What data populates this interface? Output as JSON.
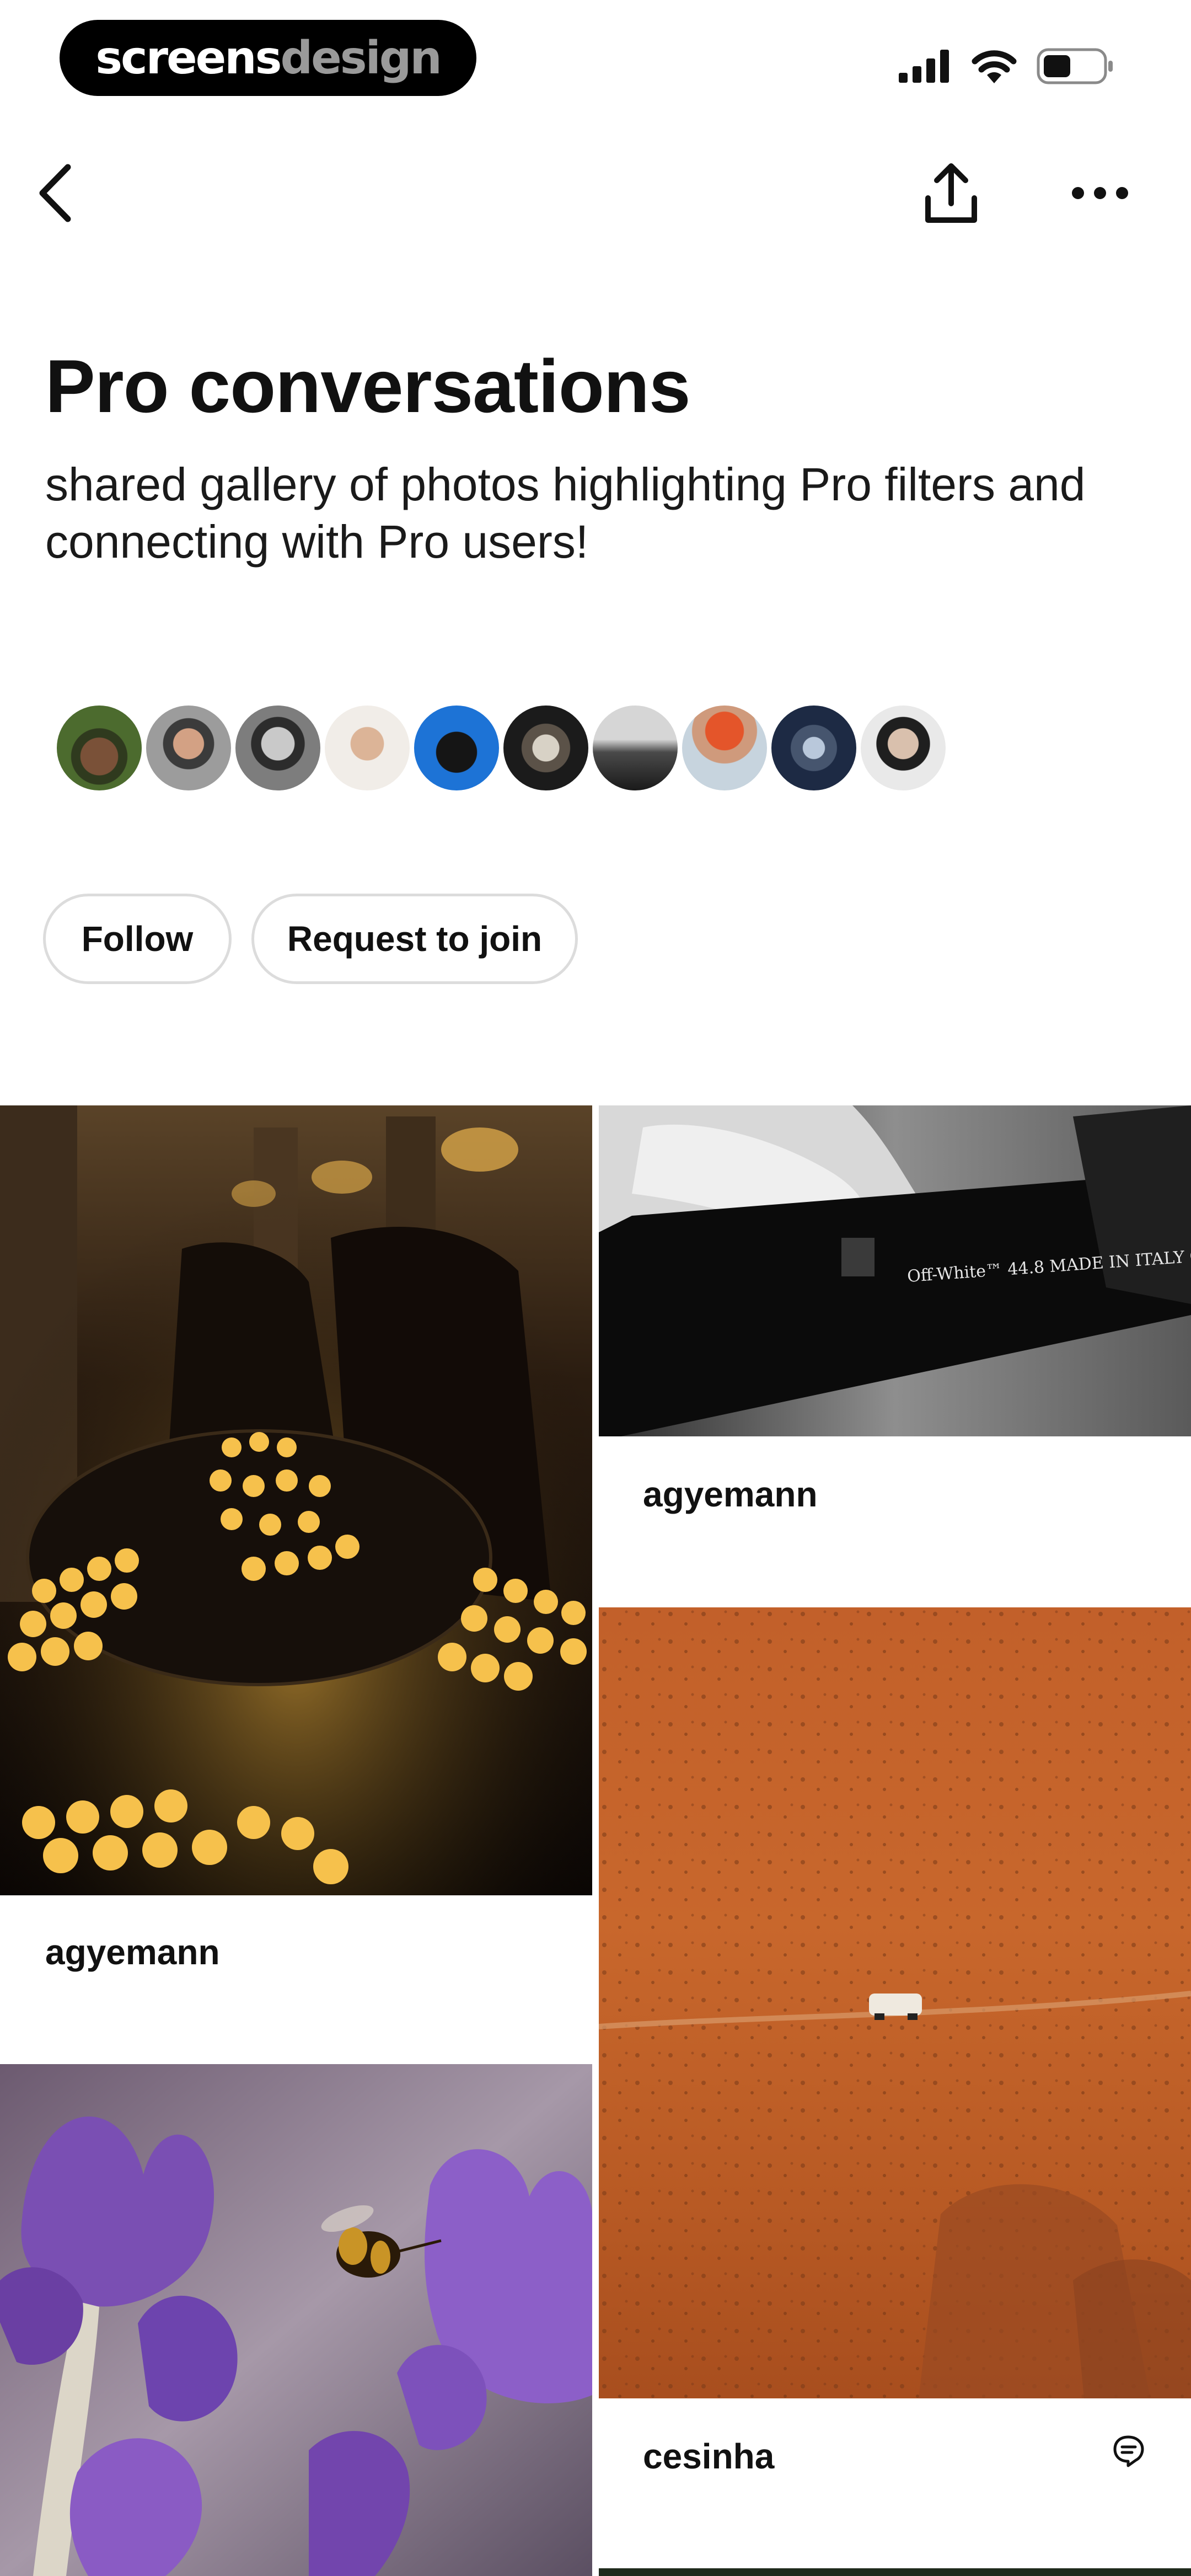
{
  "brand": {
    "part1": "screens",
    "part2": "design"
  },
  "status": {
    "signal_icon": "signal-icon",
    "wifi_icon": "wifi-icon",
    "battery_icon": "battery-icon"
  },
  "header": {
    "back_icon": "chevron-left-icon",
    "share_icon": "share-icon",
    "more_icon": "more-icon"
  },
  "board": {
    "title": "Pro conversations",
    "description": "shared gallery of photos highlighting Pro filters and connecting with Pro users!"
  },
  "collaborators": {
    "count_shown": 10
  },
  "actions": {
    "follow_label": "Follow",
    "join_label": "Request to join"
  },
  "pins": [
    {
      "author": "agyemann",
      "photo": "candles"
    },
    {
      "author": "agyemann",
      "photo": "black-and-white-hand"
    },
    {
      "author": "cesinha",
      "photo": "desert-van",
      "has_comment": true
    },
    {
      "author": "",
      "photo": "crocus-and-bee"
    }
  ],
  "colors": {
    "background": "#ffffff",
    "text": "#111111",
    "pill_border": "#dcdcdc",
    "brand_pill": "#000000"
  }
}
